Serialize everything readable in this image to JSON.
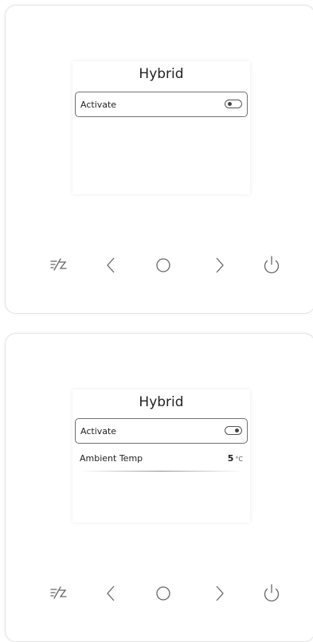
{
  "panels": [
    {
      "screen": {
        "title": "Hybrid",
        "rows": [
          {
            "label": "Activate",
            "type": "toggle",
            "toggle_state": "off",
            "selected": true
          }
        ]
      }
    },
    {
      "screen": {
        "title": "Hybrid",
        "rows": [
          {
            "label": "Activate",
            "type": "toggle",
            "toggle_state": "on",
            "selected": true
          },
          {
            "label": "Ambient Temp",
            "type": "value",
            "value": "5",
            "unit": "°C",
            "selected": false
          }
        ]
      }
    }
  ],
  "buttons": [
    {
      "icon": "mode-icon"
    },
    {
      "icon": "chevron-left-icon"
    },
    {
      "icon": "home-circle-icon"
    },
    {
      "icon": "chevron-right-icon"
    },
    {
      "icon": "power-icon"
    }
  ],
  "colors": {
    "background": "#ffffff",
    "panel_border": "#e4e4e4",
    "text": "#222222",
    "icon": "#666666"
  }
}
